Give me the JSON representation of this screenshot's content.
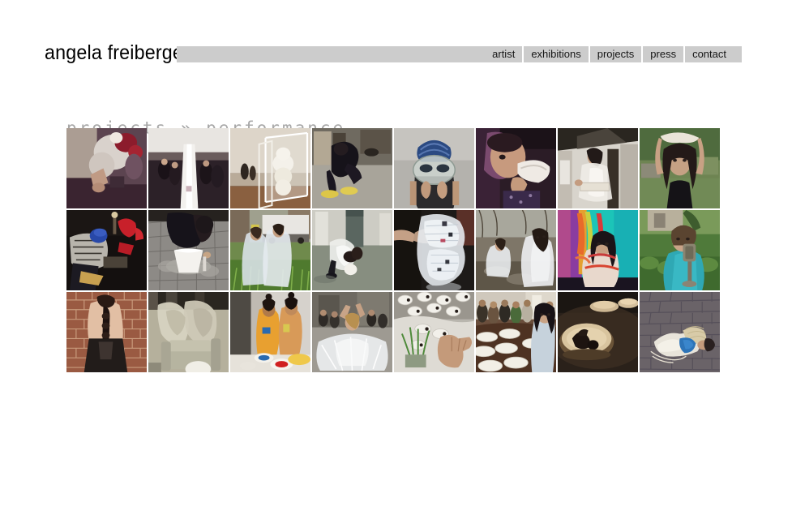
{
  "site": {
    "logo_text": "angela freiberger",
    "background_color": "#ffffff",
    "navbar_color": "#cccccc"
  },
  "nav": {
    "items": [
      {
        "label": "artist"
      },
      {
        "label": "exhibitions"
      },
      {
        "label": "projects"
      },
      {
        "label": "press"
      },
      {
        "label": "contact"
      }
    ]
  },
  "page": {
    "title_section": "projects",
    "title_separator": "»",
    "title_page": "performance",
    "title_color": "#a8a8a8"
  },
  "gallery": {
    "columns": 8,
    "rows": 3,
    "thumb_size": 99,
    "gap": 2,
    "items": [
      {
        "name": "thumb-feathered-headpiece",
        "alt": "Performer in dark dress wearing white feather and red flower headpiece"
      },
      {
        "name": "thumb-white-fabric-column",
        "alt": "Gallery audience around a tall white draped fabric column"
      },
      {
        "name": "thumb-white-forms-vitrine",
        "alt": "White rounded sculptural forms inside a wire-frame vitrine in a gallery"
      },
      {
        "name": "thumb-crouching-yellow-shoes",
        "alt": "Figure in black crouching on a floor wearing yellow shoes"
      },
      {
        "name": "thumb-blue-cap-glass-mask",
        "alt": "Close-up of performer in blue swim cap holding a glass mask to her face"
      },
      {
        "name": "thumb-white-object-purple",
        "alt": "Performer in purple light biting a white curved object"
      },
      {
        "name": "thumb-white-dress-carrying",
        "alt": "Performer in sheer white dress carrying a white box indoors"
      },
      {
        "name": "thumb-cloth-over-head",
        "alt": "Woman outdoors lifting a white cloth over her head"
      },
      {
        "name": "thumb-night-red-neon",
        "alt": "Night performance with red neon lights and figure bending over"
      },
      {
        "name": "thumb-white-basin-pavement",
        "alt": "Performer kneeling at a white basin on wet pavement"
      },
      {
        "name": "thumb-two-capes-street",
        "alt": "Two performers in translucent capes on a street with a truck"
      },
      {
        "name": "thumb-bending-gallery-floor",
        "alt": "Performer bending over in a bare gallery with white ball on floor"
      },
      {
        "name": "thumb-inflated-plastic-form",
        "alt": "Hand reaching into an illuminated inflated plastic form"
      },
      {
        "name": "thumb-capes-rocks-outdoors",
        "alt": "Two caped performers seated on rocks in a park"
      },
      {
        "name": "thumb-ribbons-teal-stage",
        "alt": "Performer bound with colored ribbons against a teal stage backdrop"
      },
      {
        "name": "thumb-metal-mouthpiece",
        "alt": "Performer in teal top holding a metal mouthpiece device outdoors"
      },
      {
        "name": "thumb-long-braid-brickwall",
        "alt": "Back of a performer with a very long braid against a brick wall"
      },
      {
        "name": "thumb-sheer-forms-chair",
        "alt": "Two figures draped in sheer fabric leaning over a pale armchair"
      },
      {
        "name": "thumb-body-paint-bowls",
        "alt": "Two body-painted performers at a table with colored bowls"
      },
      {
        "name": "thumb-white-tulle-arms-up",
        "alt": "Performer in a large white tulle skirt with arms raised before an audience"
      },
      {
        "name": "thumb-hand-white-eyes-wall",
        "alt": "Hand reaching over a white wall with eye shapes and a plant"
      },
      {
        "name": "thumb-plates-table-audience",
        "alt": "Performer in pale dress beside a table of white plates with audience"
      },
      {
        "name": "thumb-figure-in-vessel",
        "alt": "Figure lying inside a pale oval vessel in a dark room"
      },
      {
        "name": "thumb-lying-cobblestones",
        "alt": "Performer in white lying on cobblestones with blue bundle and rope"
      }
    ]
  }
}
